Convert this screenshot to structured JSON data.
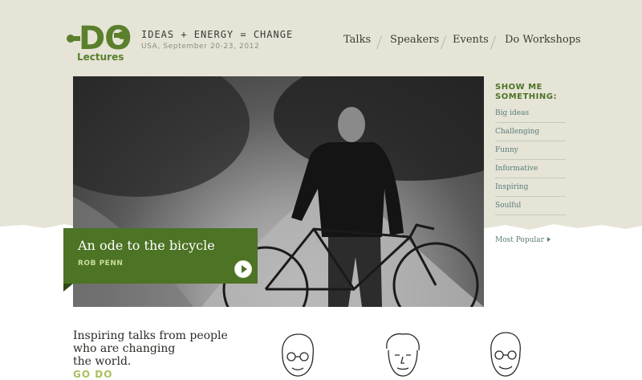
{
  "brand": {
    "logo_main": "DO",
    "logo_sub": "Lectures",
    "tagline": "IDEAS + ENERGY = CHANGE",
    "dateline": "USA, September 20-23, 2012"
  },
  "nav": {
    "items": [
      "Talks",
      "Speakers",
      "Events",
      "Do Workshops"
    ]
  },
  "hero": {
    "title": "An ode to the bicycle",
    "author": "ROB PENN"
  },
  "sidebar": {
    "title_line1": "SHOW ME",
    "title_line2": "SOMETHING:",
    "items": [
      "Big ideas",
      "Challenging",
      "Funny",
      "Informative",
      "Inspiring",
      "Soulful"
    ],
    "most_popular": "Most Popular"
  },
  "intro": {
    "line1": "Inspiring talks from people",
    "line2": "who are changing",
    "line3": "the world.",
    "cta": "GO DO"
  },
  "colors": {
    "brand_green": "#4d7325",
    "paper": "#e5e4d7",
    "link": "#5a7c77"
  }
}
